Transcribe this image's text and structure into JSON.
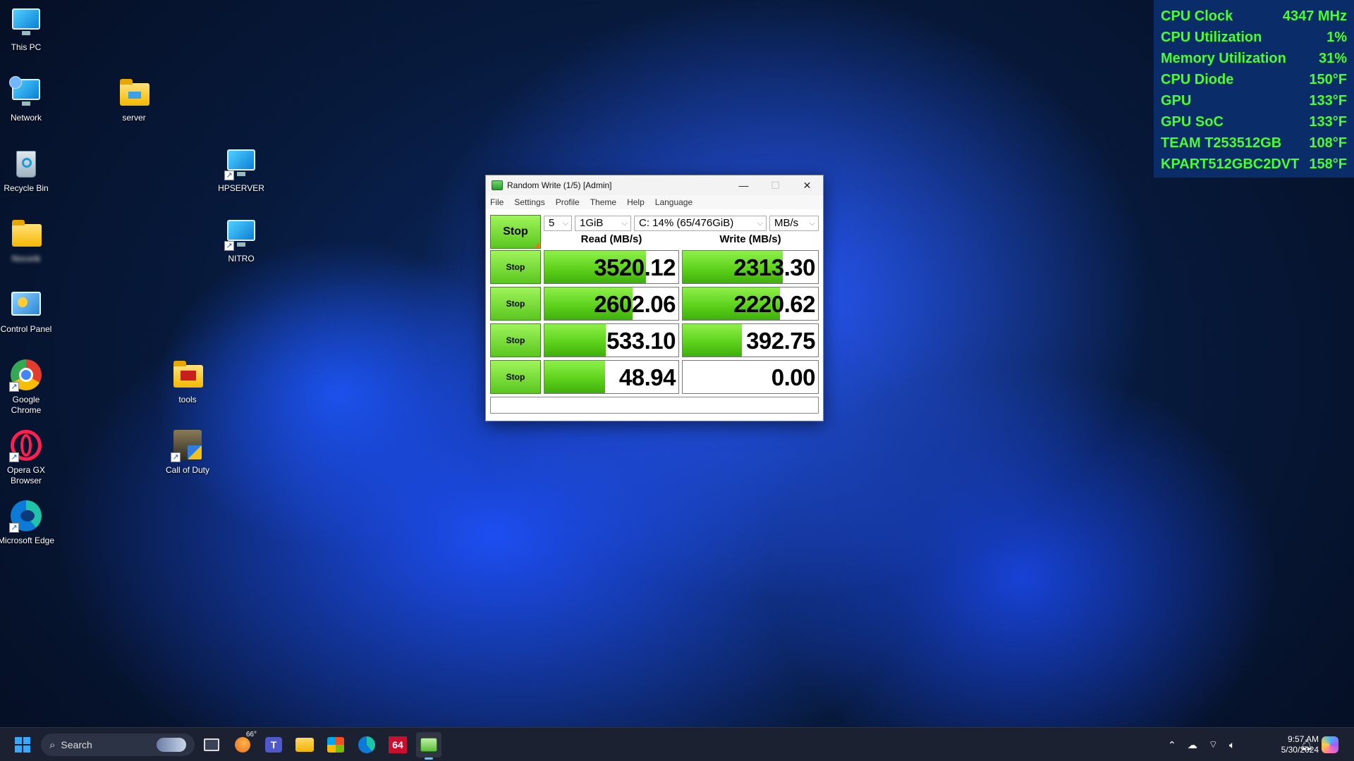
{
  "desktop": {
    "icons": [
      {
        "label": "This PC"
      },
      {
        "label": "Network"
      },
      {
        "label": "Recycle Bin"
      },
      {
        "label": "Nocorik"
      },
      {
        "label": "Control Panel"
      },
      {
        "label": "Google Chrome"
      },
      {
        "label": "Opera GX Browser"
      },
      {
        "label": "Microsoft Edge"
      },
      {
        "label": "server"
      },
      {
        "label": "HPSERVER"
      },
      {
        "label": "NITRO"
      },
      {
        "label": "tools"
      },
      {
        "label": "Call of Duty"
      }
    ]
  },
  "sensors": [
    {
      "label": "CPU Clock",
      "value": "4347 MHz"
    },
    {
      "label": "CPU Utilization",
      "value": "1%"
    },
    {
      "label": "Memory Utilization",
      "value": "31%"
    },
    {
      "label": "CPU Diode",
      "value": "150°F"
    },
    {
      "label": "GPU",
      "value": "133°F"
    },
    {
      "label": "GPU SoC",
      "value": "133°F"
    },
    {
      "label": "TEAM T253512GB",
      "value": "108°F"
    },
    {
      "label": "KPART512GBC2DVT",
      "value": "158°F"
    }
  ],
  "window": {
    "title": "Random Write (1/5) [Admin]",
    "menu": [
      "File",
      "Settings",
      "Profile",
      "Theme",
      "Help",
      "Language"
    ],
    "controls": {
      "stop_main": "Stop",
      "count": "5",
      "size": "1GiB",
      "drive": "C: 14% (65/476GiB)",
      "unit": "MB/s"
    },
    "headers": {
      "read": "Read (MB/s)",
      "write": "Write (MB/s)"
    },
    "rows": [
      {
        "stop": "Stop",
        "read": "3520.12",
        "read_fill": 0.76,
        "write": "2313.30",
        "write_fill": 0.74
      },
      {
        "stop": "Stop",
        "read": "2602.06",
        "read_fill": 0.66,
        "write": "2220.62",
        "write_fill": 0.72
      },
      {
        "stop": "Stop",
        "read": "533.10",
        "read_fill": 0.46,
        "write": "392.75",
        "write_fill": 0.44
      },
      {
        "stop": "Stop",
        "read": "48.94",
        "read_fill": 0.45,
        "write": "0.00",
        "write_fill": 0
      }
    ]
  },
  "taskbar": {
    "search_placeholder": "Search",
    "weather": "66°",
    "aida_label": "64",
    "time": "9:57 AM",
    "date": "5/30/2024"
  },
  "colors": {
    "sensor_text": "#47ff2b",
    "sensor_bg": "#0a2d6a",
    "bar_fill": "#5ed21c",
    "accent": "#38a8ff"
  }
}
